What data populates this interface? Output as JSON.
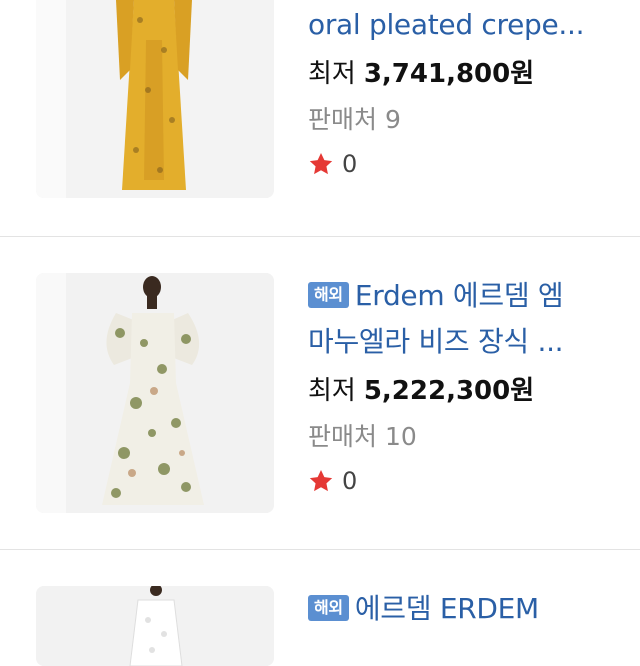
{
  "products": [
    {
      "badge": "",
      "title_lines": [
        "oral pleated crepe..."
      ],
      "price_label": "최저",
      "price_value": "3,741,800원",
      "seller_text": "판매처 9",
      "rating_value": "0",
      "icons": {
        "rating": "star-icon"
      },
      "colors": {
        "dress": "#e3ae2c"
      }
    },
    {
      "badge": "해외",
      "title_lines": [
        "Erdem 에르뎀 엠",
        "마누엘라 비즈 장식 ..."
      ],
      "price_label": "최저",
      "price_value": "5,222,300원",
      "seller_text": "판매처 10",
      "rating_value": "0",
      "icons": {
        "rating": "star-icon"
      },
      "colors": {
        "dress": "#f1efe6"
      }
    },
    {
      "badge": "해외",
      "title_lines": [
        "에르뎀 ERDEM"
      ],
      "colors": {
        "dress": "#ffffff"
      }
    }
  ],
  "colors": {
    "title": "#2a5fa6",
    "badge": "#5b8fd1",
    "star": "#e53935",
    "seller_text": "#8a8a8a"
  }
}
